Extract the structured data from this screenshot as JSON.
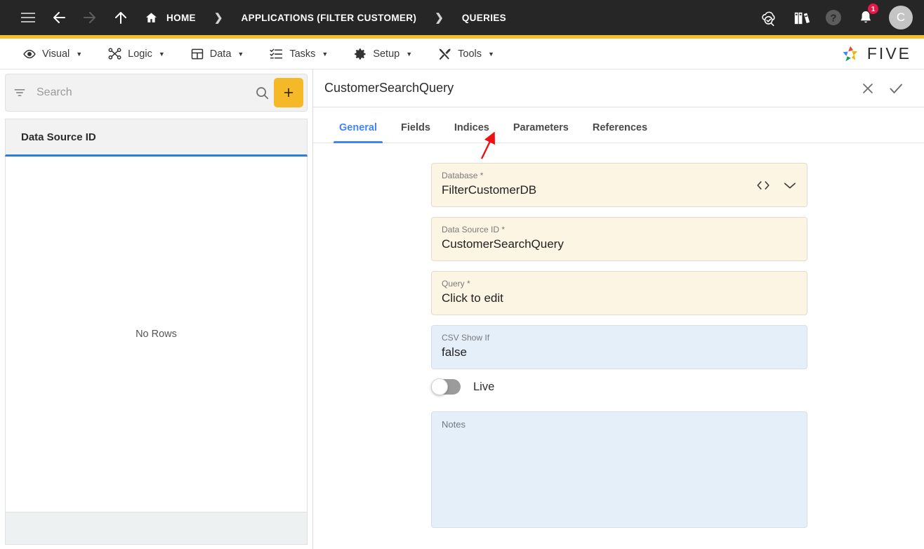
{
  "topbar": {
    "menu_icon": "hamburger-icon",
    "back_icon": "arrow-left-icon",
    "forward_icon": "arrow-right-icon",
    "up_icon": "arrow-up-icon",
    "home_icon": "home-icon",
    "breadcrumbs": [
      {
        "label": "HOME"
      },
      {
        "label": "APPLICATIONS (FILTER CUSTOMER)"
      },
      {
        "label": "QUERIES"
      }
    ],
    "separator": "❯",
    "right_icons": [
      {
        "name": "cloud-check-icon"
      },
      {
        "name": "library-books-icon"
      },
      {
        "name": "help-icon"
      },
      {
        "name": "notifications-bell-icon"
      }
    ],
    "notification_count": "1",
    "avatar_initial": "C",
    "accent_color": "#F4BE2C"
  },
  "menubar": {
    "items": [
      {
        "label": "Visual",
        "icon": "eye-icon"
      },
      {
        "label": "Logic",
        "icon": "logic-nodes-icon"
      },
      {
        "label": "Data",
        "icon": "table-icon"
      },
      {
        "label": "Tasks",
        "icon": "task-list-icon"
      },
      {
        "label": "Setup",
        "icon": "gear-icon"
      },
      {
        "label": "Tools",
        "icon": "tools-icon"
      }
    ],
    "caret": "▼",
    "logo_text": "FIVE"
  },
  "left_panel": {
    "filter_icon": "filter-icon",
    "search_placeholder": "Search",
    "search_value": "",
    "search_icon": "search-icon",
    "add_label": "+",
    "column_header": "Data Source ID",
    "empty_message": "No Rows"
  },
  "right_panel": {
    "title": "CustomerSearchQuery",
    "close_icon": "close-icon",
    "confirm_icon": "check-icon",
    "tabs": [
      {
        "label": "General",
        "active": true
      },
      {
        "label": "Fields",
        "active": false
      },
      {
        "label": "Indices",
        "active": false
      },
      {
        "label": "Parameters",
        "active": false
      },
      {
        "label": "References",
        "active": false
      }
    ],
    "fields": {
      "database": {
        "label": "Database *",
        "value": "FilterCustomerDB",
        "code_icon": "code-brackets-icon",
        "dropdown_icon": "chevron-down-icon"
      },
      "data_source_id": {
        "label": "Data Source ID *",
        "value": "CustomerSearchQuery"
      },
      "query": {
        "label": "Query *",
        "value": "Click to edit"
      },
      "csv_show_if": {
        "label": "CSV Show If",
        "value": "false"
      },
      "live": {
        "label": "Live",
        "state": "off"
      },
      "notes": {
        "label": "Notes",
        "value": ""
      }
    }
  },
  "annotation": {
    "arrow_color": "#EE1111",
    "points_to": "Parameters"
  }
}
